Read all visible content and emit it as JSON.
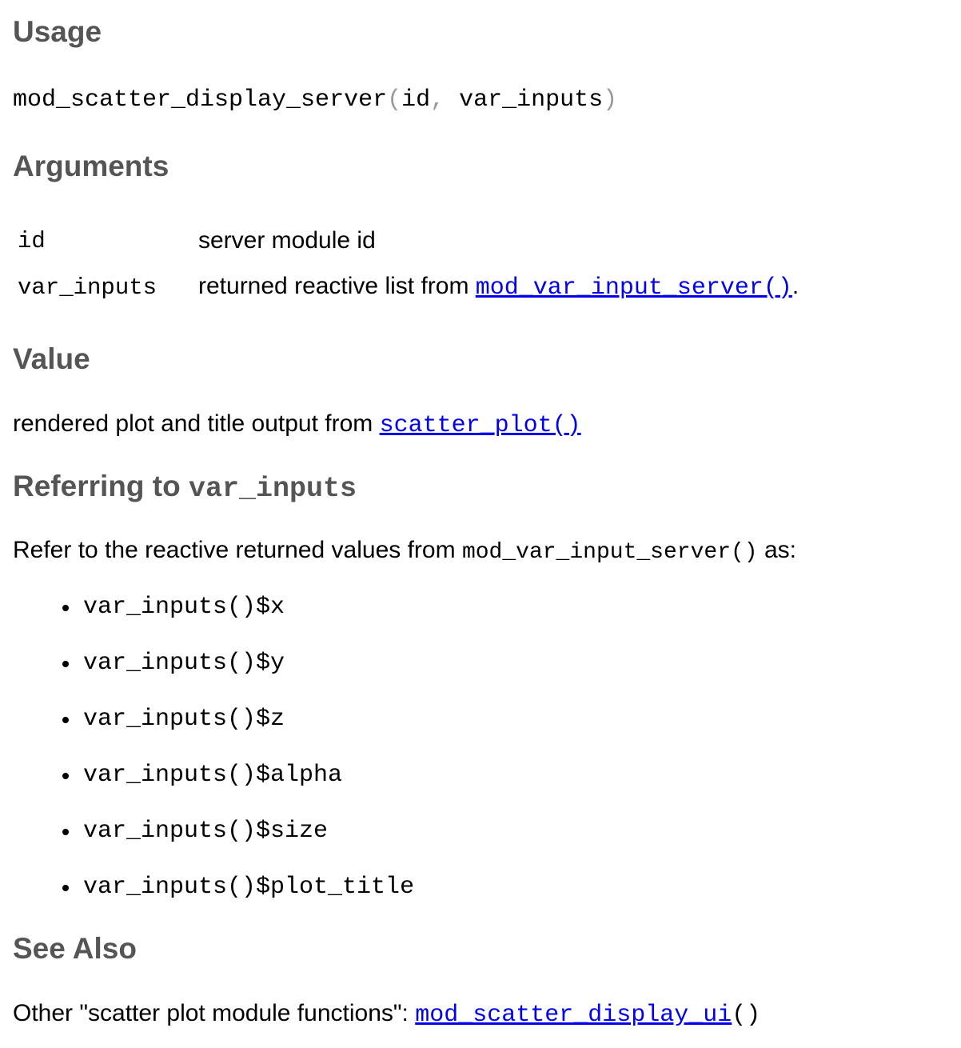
{
  "usage": {
    "heading": "Usage",
    "function_name": "mod_scatter_display_server",
    "open_paren": "(",
    "arg1": "id",
    "comma": ",",
    "arg2": "var_inputs",
    "close_paren": ")"
  },
  "arguments": {
    "heading": "Arguments",
    "rows": [
      {
        "name": "id",
        "description": "server module id",
        "link": "",
        "suffix": ""
      },
      {
        "name": "var_inputs",
        "description": "returned reactive list from ",
        "link": "mod_var_input_server()",
        "suffix": "."
      }
    ]
  },
  "value": {
    "heading": "Value",
    "text": "rendered plot and title output from ",
    "link": "scatter_plot()"
  },
  "referring": {
    "heading_text": "Referring to ",
    "heading_code": "var_inputs",
    "intro_before": "Refer to the reactive returned values from ",
    "intro_code": "mod_var_input_server()",
    "intro_after": " as:",
    "items": [
      "var_inputs()$x",
      "var_inputs()$y",
      "var_inputs()$z",
      "var_inputs()$alpha",
      "var_inputs()$size",
      "var_inputs()$plot_title"
    ]
  },
  "see_also": {
    "heading": "See Also",
    "text": "Other \"scatter plot module functions\": ",
    "link": "mod_scatter_display_ui",
    "suffix": "()"
  },
  "colors": {
    "heading": "#555555",
    "link": "#0000ee",
    "paren": "#999999"
  }
}
